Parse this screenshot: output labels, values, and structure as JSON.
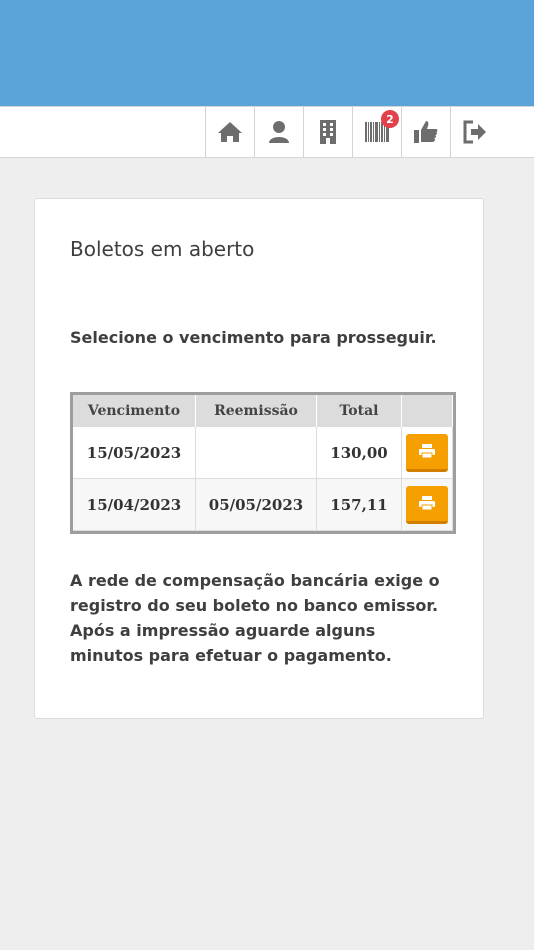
{
  "nav": {
    "icons": [
      "home-icon",
      "user-icon",
      "building-icon",
      "barcode-icon",
      "thumbs-up-icon",
      "logout-icon"
    ],
    "barcode_badge": "2"
  },
  "card": {
    "title": "Boletos em aberto",
    "instruction": "Selecione o vencimento para prosseguir.",
    "table": {
      "headers": [
        "Vencimento",
        "Reemissão",
        "Total",
        ""
      ],
      "rows": [
        {
          "vencimento": "15/05/2023",
          "reemissao": "",
          "total": "130,00"
        },
        {
          "vencimento": "15/04/2023",
          "reemissao": "05/05/2023",
          "total": "157,11"
        }
      ]
    },
    "footer": "A rede de compensação bancária exige o registro do seu boleto no banco emissor. Após a impressão aguarde alguns minutos para efetuar o pagamento."
  },
  "colors": {
    "header_bg": "#5ba4da",
    "print_button": "#f5a000",
    "badge": "#e2404a"
  }
}
